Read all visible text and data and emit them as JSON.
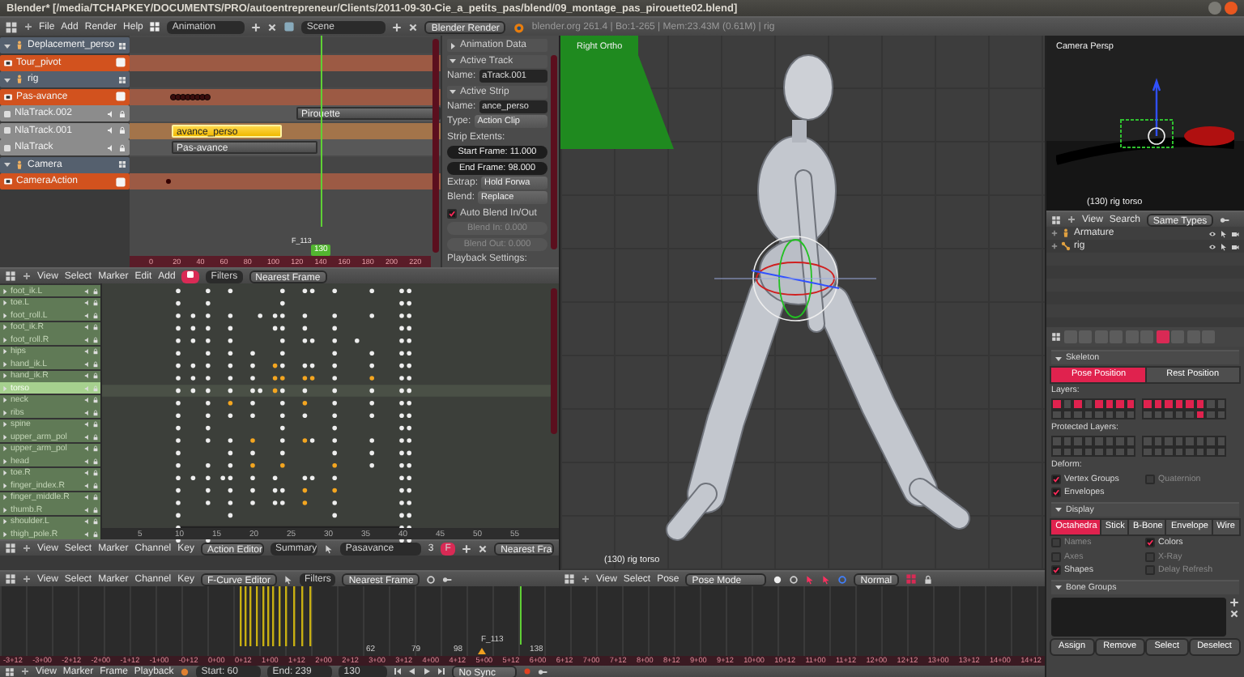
{
  "window": {
    "title": "Blender* [/media/TCHAPKEY/DOCUMENTS/PRO/autoentrepreneur/Clients/2011-09-30-Cie_a_petits_pas/blend/09_montage_pas_pirouette02.blend]"
  },
  "info_bar": {
    "menus": [
      "File",
      "Add",
      "Render",
      "Help"
    ],
    "layout": "Animation",
    "scene": "Scene",
    "engine": "Blender Render",
    "stats": "blender.org 261.4 | Bo:1-265 | Mem:23.43M (0.61M) | rig"
  },
  "nla": {
    "channels": [
      {
        "kind": "object",
        "name": "Deplacement_perso"
      },
      {
        "kind": "action",
        "name": "Tour_pivot"
      },
      {
        "kind": "object",
        "name": "rig"
      },
      {
        "kind": "action",
        "name": "Pas-avance"
      },
      {
        "kind": "track",
        "name": "NlaTrack.002",
        "strip": {
          "name": "Pirouette",
          "selected": false
        }
      },
      {
        "kind": "track",
        "name": "NlaTrack.001",
        "strip": {
          "name": "avance_perso",
          "selected": true
        }
      },
      {
        "kind": "track",
        "name": "NlaTrack",
        "strip": {
          "name": "Pas-avance",
          "selected": false
        }
      },
      {
        "kind": "object",
        "name": "Camera"
      },
      {
        "kind": "action",
        "name": "CameraAction"
      }
    ],
    "ruler": [
      "0",
      "20",
      "40",
      "60",
      "80",
      "100",
      "120",
      "140",
      "160",
      "180",
      "200",
      "220"
    ],
    "current_frame": "130",
    "marker": "F_113"
  },
  "nla_sidebar": [
    {
      "kind": "header",
      "text": "Animation Data",
      "expanded": false
    },
    {
      "kind": "header",
      "text": "Active Track",
      "expanded": true
    },
    {
      "kind": "field",
      "label": "Name:",
      "value": "aTrack.001"
    },
    {
      "kind": "header",
      "text": "Active Strip",
      "expanded": true
    },
    {
      "kind": "field",
      "label": "Name:",
      "value": "ance_perso"
    },
    {
      "kind": "dropdown",
      "label": "Type:",
      "value": "Action Clip"
    },
    {
      "kind": "label",
      "text": "Strip Extents:"
    },
    {
      "kind": "number",
      "text": "Start Frame: 11.000",
      "disabled": false
    },
    {
      "kind": "number",
      "text": "End Frame: 98.000",
      "disabled": false
    },
    {
      "kind": "dropdown",
      "label": "Extrap:",
      "value": "Hold Forwa"
    },
    {
      "kind": "dropdown",
      "label": "Blend:",
      "value": "Replace"
    },
    {
      "kind": "checkbox",
      "text": "Auto Blend In/Out",
      "checked": true
    },
    {
      "kind": "number",
      "text": "Blend In: 0.000",
      "disabled": true
    },
    {
      "kind": "number",
      "text": "Blend Out: 0.000",
      "disabled": true
    },
    {
      "kind": "label",
      "text": "Playback Settings:"
    }
  ],
  "dopesheet": {
    "menus": [
      "View",
      "Select",
      "Marker",
      "Edit",
      "Add"
    ],
    "filters": "Filters",
    "snap": "Nearest Frame",
    "channels": [
      {
        "name": "foot_ik.L",
        "selected": false
      },
      {
        "name": "toe.L",
        "selected": false
      },
      {
        "name": "foot_roll.L",
        "selected": false
      },
      {
        "name": "foot_ik.R",
        "selected": false
      },
      {
        "name": "foot_roll.R",
        "selected": false
      },
      {
        "name": "hips",
        "selected": false
      },
      {
        "name": "hand_ik.L",
        "selected": false
      },
      {
        "name": "hand_ik.R",
        "selected": false
      },
      {
        "name": "torso",
        "selected": true
      },
      {
        "name": "neck",
        "selected": false
      },
      {
        "name": "ribs",
        "selected": false
      },
      {
        "name": "spine",
        "selected": false
      },
      {
        "name": "upper_arm_pol",
        "selected": false
      },
      {
        "name": "upper_arm_pol",
        "selected": false
      },
      {
        "name": "head",
        "selected": false
      },
      {
        "name": "toe.R",
        "selected": false
      },
      {
        "name": "finger_index.R",
        "selected": false
      },
      {
        "name": "finger_middle.R",
        "selected": false
      },
      {
        "name": "thumb.R",
        "selected": false
      },
      {
        "name": "shoulder.L",
        "selected": false
      },
      {
        "name": "thigh_pole.R",
        "selected": false
      }
    ],
    "ruler": [
      "5",
      "10",
      "15",
      "20",
      "25",
      "30",
      "35",
      "40",
      "45",
      "50",
      "55"
    ]
  },
  "action_editor": {
    "menus": [
      "View",
      "Select",
      "Marker",
      "Channel",
      "Key"
    ],
    "mode": "Action Editor",
    "summary": "Summary",
    "action": "Pasavance",
    "users": "3",
    "fake_user": "F",
    "snap": "Nearest Fra"
  },
  "fcurve_editor": {
    "menus": [
      "View",
      "Select",
      "Marker",
      "Channel",
      "Key"
    ],
    "mode": "F-Curve Editor",
    "filters": "Filters",
    "snap": "Nearest Frame"
  },
  "viewport": {
    "view": "Right Ortho",
    "status": "(130) rig torso",
    "menus": [
      "View",
      "Select",
      "Pose"
    ],
    "mode": "Pose Mode",
    "orientation": "Normal"
  },
  "graph": {
    "marker": "F_113",
    "labels": [
      "62",
      "79",
      "98",
      "138"
    ],
    "timecodes": [
      "-3+12",
      "-3+00",
      "-2+12",
      "-2+00",
      "-1+12",
      "-1+00",
      "-0+12",
      "0+00",
      "0+12",
      "1+00",
      "1+12",
      "2+00",
      "2+12",
      "3+00",
      "3+12",
      "4+00",
      "4+12",
      "5+00",
      "5+12",
      "6+00",
      "6+12",
      "7+00",
      "7+12",
      "8+00",
      "8+12",
      "9+00",
      "9+12",
      "10+00",
      "10+12",
      "11+00",
      "11+12",
      "12+00",
      "12+12",
      "13+00",
      "13+12",
      "14+00",
      "14+12"
    ]
  },
  "timeline": {
    "menus": [
      "View",
      "Marker",
      "Frame",
      "Playback"
    ],
    "start": "Start: 60",
    "end": "End: 239",
    "frame": "130",
    "sync": "No Sync"
  },
  "camera_view": {
    "view": "Camera Persp",
    "status": "(130) rig torso"
  },
  "outliner": {
    "menus": [
      "View",
      "Search"
    ],
    "filter": "Same Types",
    "items": [
      {
        "name": "Armature"
      },
      {
        "name": "rig"
      }
    ]
  },
  "properties": {
    "tabs": [
      {
        "selected": false
      },
      {
        "selected": false
      },
      {
        "selected": false
      },
      {
        "selected": false
      },
      {
        "selected": false
      },
      {
        "selected": false
      },
      {
        "selected": true
      },
      {
        "selected": false
      },
      {
        "selected": false
      },
      {
        "selected": false
      }
    ],
    "skeleton": {
      "title": "Skeleton",
      "expanded": true,
      "positions": [
        {
          "label": "Pose Position",
          "selected": true
        },
        {
          "label": "Rest Position",
          "selected": false
        }
      ],
      "layers_label": "Layers:",
      "layers": [
        true,
        false,
        true,
        false,
        true,
        true,
        true,
        true,
        false,
        false,
        false,
        false,
        false,
        false,
        false,
        false,
        true,
        true,
        true,
        true,
        true,
        true,
        false,
        false,
        false,
        false,
        false,
        false,
        false,
        true,
        false,
        false
      ],
      "protected_label": "Protected Layers:",
      "protected": [
        false,
        false,
        false,
        false,
        false,
        false,
        false,
        false,
        false,
        false,
        false,
        false,
        false,
        false,
        false,
        false,
        false,
        false,
        false,
        false,
        false,
        false,
        false,
        false,
        false,
        false,
        false,
        false,
        false,
        false,
        false,
        false
      ],
      "deform_label": "Deform:",
      "deform": [
        {
          "label": "Vertex Groups",
          "checked": true
        },
        {
          "label": "Quaternion",
          "checked": false
        },
        {
          "label": "Envelopes",
          "checked": true
        }
      ]
    },
    "display": {
      "title": "Display",
      "expanded": true,
      "styles": [
        {
          "label": "Octahedra",
          "selected": true
        },
        {
          "label": "Stick",
          "selected": false
        },
        {
          "label": "B-Bone",
          "selected": false
        },
        {
          "label": "Envelope",
          "selected": false
        },
        {
          "label": "Wire",
          "selected": false
        }
      ],
      "options": [
        {
          "label": "Names",
          "checked": false
        },
        {
          "label": "Colors",
          "checked": true
        },
        {
          "label": "Axes",
          "checked": false
        },
        {
          "label": "X-Ray",
          "checked": false
        },
        {
          "label": "Shapes",
          "checked": true
        },
        {
          "label": "Delay Refresh",
          "checked": false
        }
      ]
    },
    "bone_groups": {
      "title": "Bone Groups",
      "expanded": true,
      "buttons": [
        "Assign",
        "Remove",
        "Select",
        "Deselect"
      ]
    }
  }
}
